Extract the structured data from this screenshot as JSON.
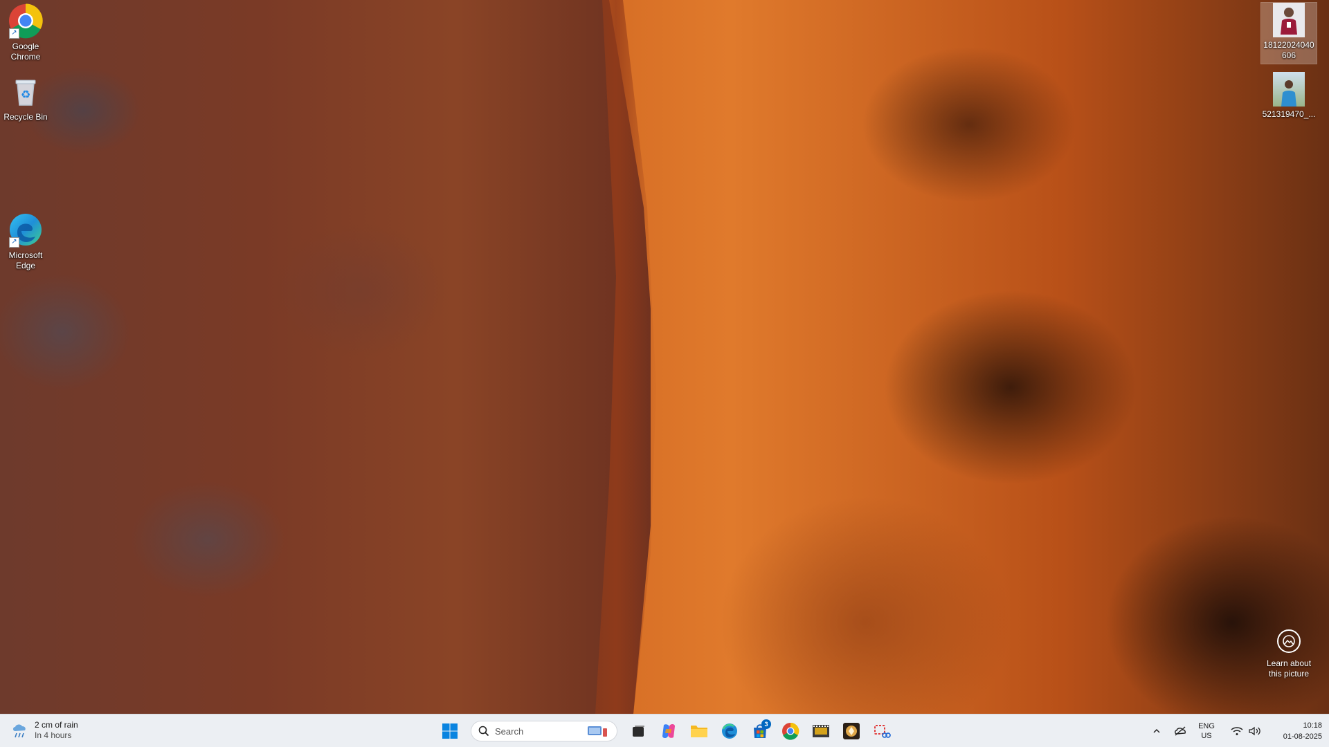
{
  "desktop": {
    "icons_left": [
      {
        "label": "Google Chrome"
      },
      {
        "label": "Recycle Bin"
      },
      {
        "label": "Microsoft Edge"
      }
    ],
    "icons_right": [
      {
        "label": "18122024040606"
      },
      {
        "label": "521319470_..."
      }
    ],
    "learn": {
      "line1": "Learn about",
      "line2": "this picture"
    }
  },
  "taskbar": {
    "weather": {
      "title": "2 cm of rain",
      "subtitle": "In 4 hours"
    },
    "search": {
      "placeholder": "Search"
    },
    "store_badge": "3",
    "tray": {
      "lang_top": "ENG",
      "lang_bottom": "US",
      "time": "10:18",
      "date": "01-08-2025"
    }
  },
  "colors": {
    "taskbar_bg": "#eceff3",
    "accent": "#0067c0"
  }
}
